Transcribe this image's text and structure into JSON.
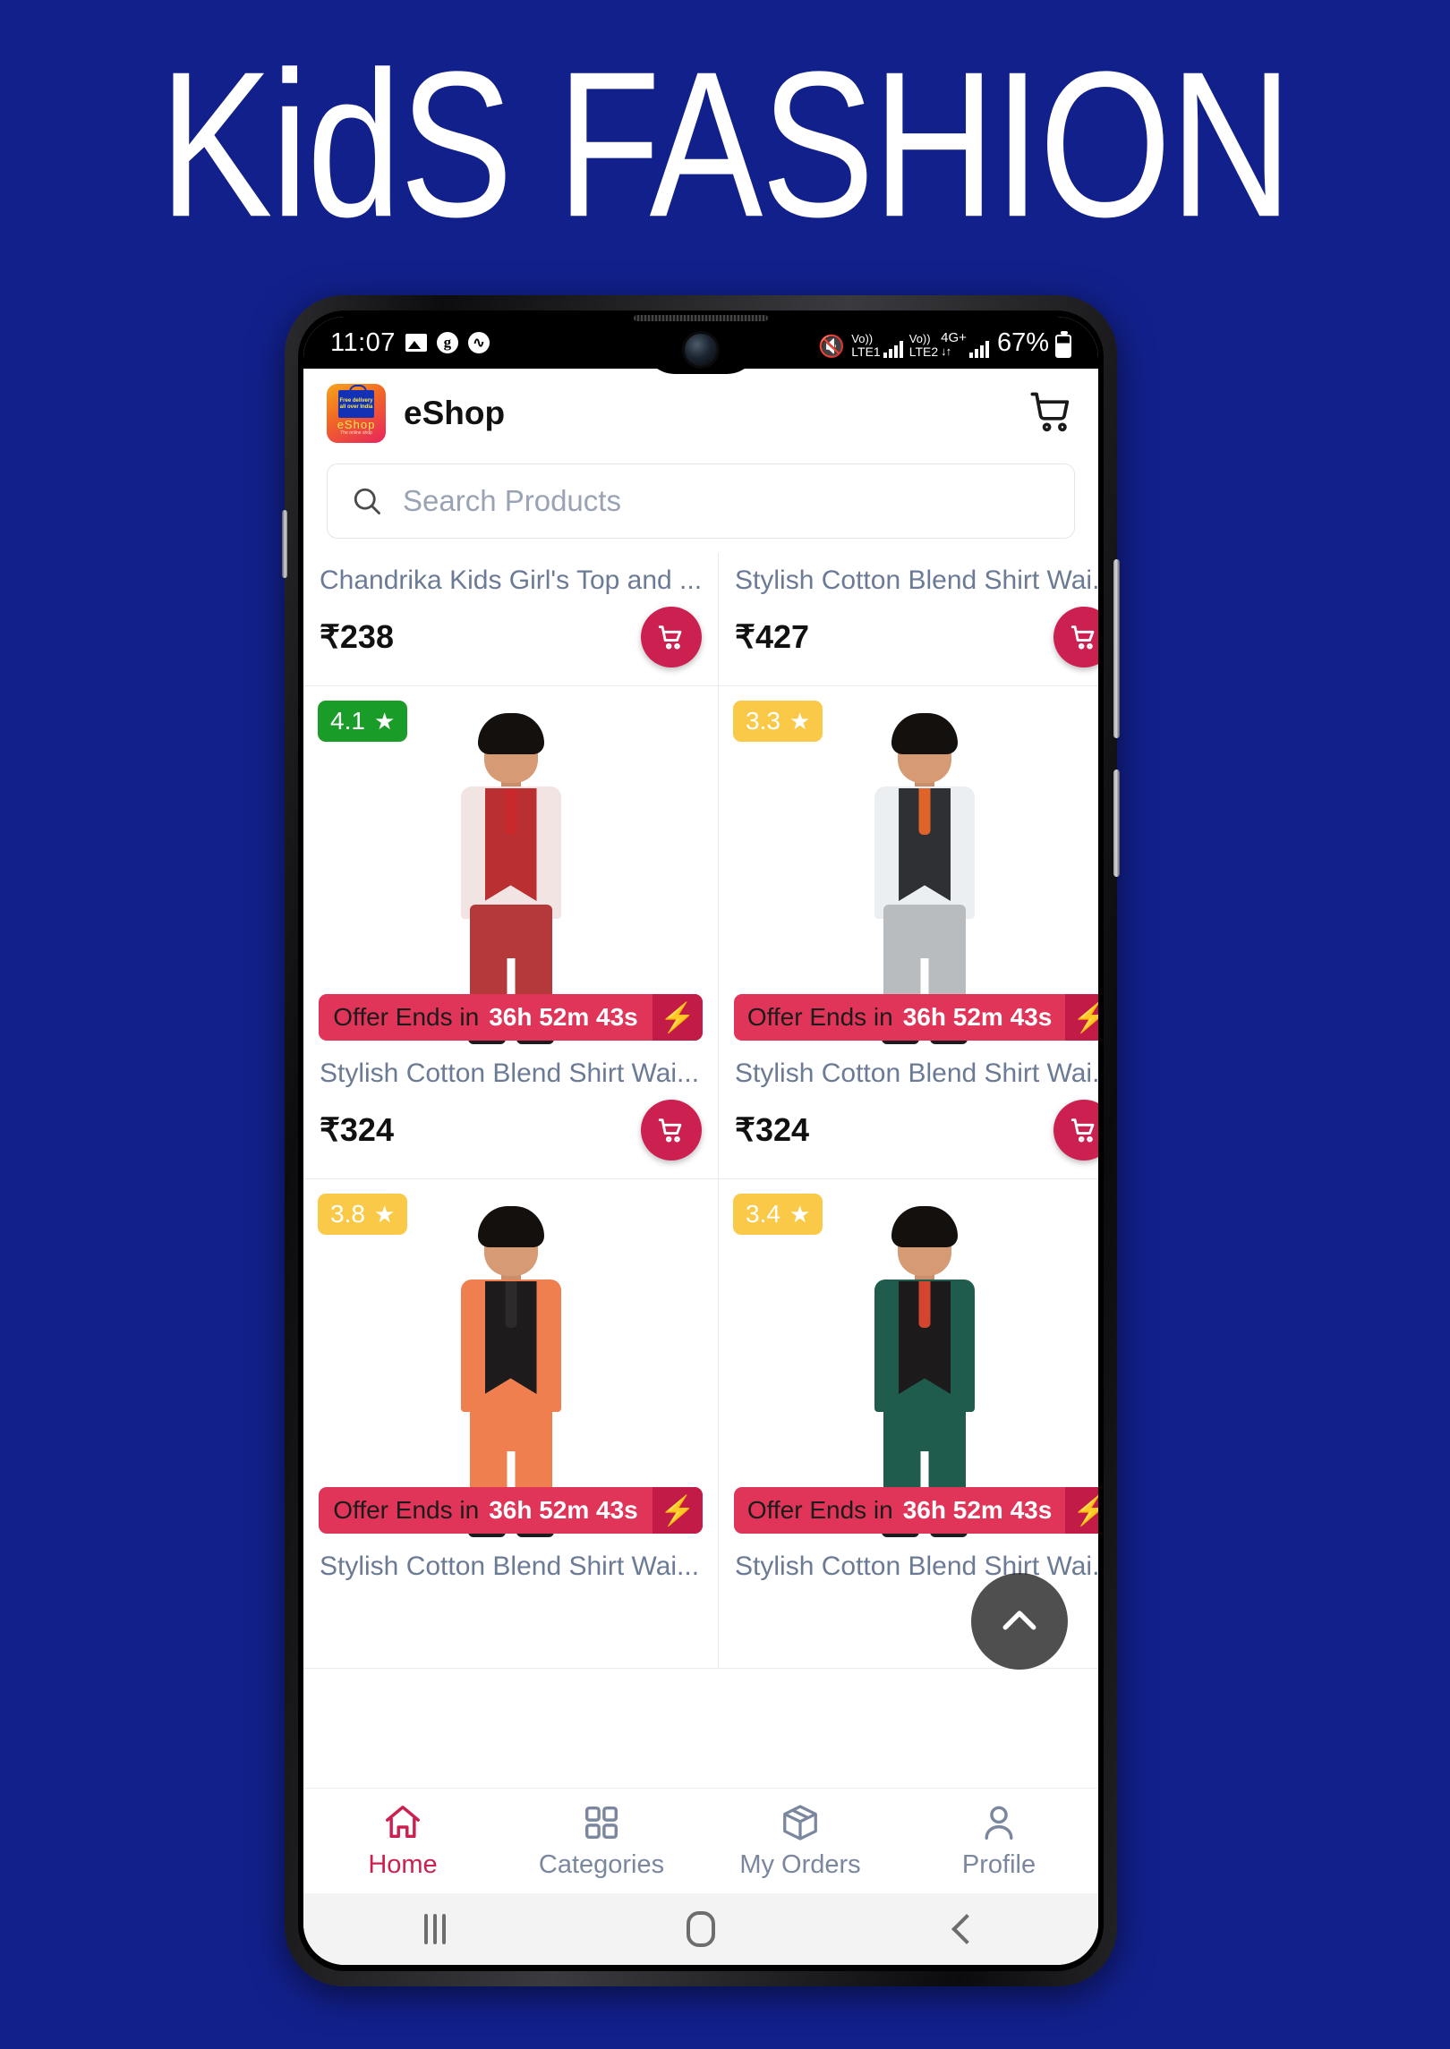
{
  "poster": {
    "title": "KidS FASHION",
    "background_color": "#12208c"
  },
  "status_bar": {
    "time": "11:07",
    "icons": [
      "photo-icon",
      "google-icon",
      "messenger-icon",
      "mute-icon"
    ],
    "google_glyph": "g",
    "messenger_glyph": "∿",
    "mute_glyph": "🔇",
    "sim1_vo": "Vo))",
    "sim1_label": "LTE1",
    "sim2_vo": "Vo))",
    "sim2_label": "LTE2",
    "network": "4G+",
    "network_arrows": "↓↑",
    "battery": "67%"
  },
  "app_header": {
    "title": "eShop",
    "logo_bag_line1": "Free delivery",
    "logo_bag_line2": "all over India",
    "logo_brand": "eShop",
    "logo_tagline": "The online shop",
    "cart_icon": "cart-icon"
  },
  "search": {
    "placeholder": "Search Products",
    "icon": "search-icon"
  },
  "colors": {
    "accent": "#cc2150",
    "offer_red": "#e03458",
    "offer_bolt": "#c21b48",
    "rating_green": "#1a9d28",
    "rating_amber": "#fbc948",
    "title_text": "#6b7a95",
    "nav_inactive": "#7a879e"
  },
  "products": [
    {
      "title": "Chandrika Kids Girl's Top and ...",
      "price": "₹238",
      "cart_icon": "add-to-cart-icon",
      "partial": true
    },
    {
      "title": "Stylish Cotton Blend Shirt Wai...",
      "price": "₹427",
      "cart_icon": "add-to-cart-icon",
      "partial": true
    },
    {
      "title": "Stylish Cotton Blend Shirt Wai...",
      "price": "₹324",
      "rating": "4.1",
      "rating_color": "#1a9d28",
      "star": "★",
      "offer_label": "Offer Ends in",
      "offer_time": "36h 52m 43s",
      "bolt": "⚡",
      "cart_icon": "add-to-cart-icon",
      "outfit": {
        "vest": "#b92f32",
        "shirt": "#f2e4e2",
        "tie": "#c9282c",
        "pants": "#b5393a"
      }
    },
    {
      "title": "Stylish Cotton Blend Shirt Wai...",
      "price": "₹324",
      "rating": "3.3",
      "rating_color": "#fbc948",
      "star": "★",
      "offer_label": "Offer Ends in",
      "offer_time": "36h 52m 43s",
      "bolt": "⚡",
      "cart_icon": "add-to-cart-icon",
      "outfit": {
        "vest": "#2f3034",
        "shirt": "#eceff1",
        "tie": "#e0632a",
        "pants": "#b9bcbe"
      }
    },
    {
      "title": "Stylish Cotton Blend Shirt Wai...",
      "price": "",
      "rating": "3.8",
      "rating_color": "#fbc948",
      "star": "★",
      "offer_label": "Offer Ends in",
      "offer_time": "36h 52m 43s",
      "bolt": "⚡",
      "cart_icon": "add-to-cart-icon",
      "outfit": {
        "vest": "#1d1b1c",
        "shirt": "#ef7f4e",
        "tie": "#2c2a2b",
        "pants": "#ef7f4e"
      }
    },
    {
      "title": "Stylish Cotton Blend Shirt Wai...",
      "price": "",
      "rating": "3.4",
      "rating_color": "#fbc948",
      "star": "★",
      "offer_label": "Offer Ends in",
      "offer_time": "36h 52m 43s",
      "bolt": "⚡",
      "cart_icon": "add-to-cart-icon",
      "outfit": {
        "vest": "#1c1a1a",
        "shirt": "#1f5c4e",
        "tie": "#d4452f",
        "pants": "#1f5c4e"
      }
    }
  ],
  "fab": {
    "icon": "chevron-up-icon"
  },
  "bottom_nav": [
    {
      "label": "Home",
      "icon": "home-icon",
      "active": true
    },
    {
      "label": "Categories",
      "icon": "grid-icon",
      "active": false
    },
    {
      "label": "My Orders",
      "icon": "box-icon",
      "active": false
    },
    {
      "label": "Profile",
      "icon": "person-icon",
      "active": false
    }
  ],
  "android_nav": {
    "recent": "recent-apps-icon",
    "home": "home-circle-icon",
    "back": "back-icon"
  }
}
